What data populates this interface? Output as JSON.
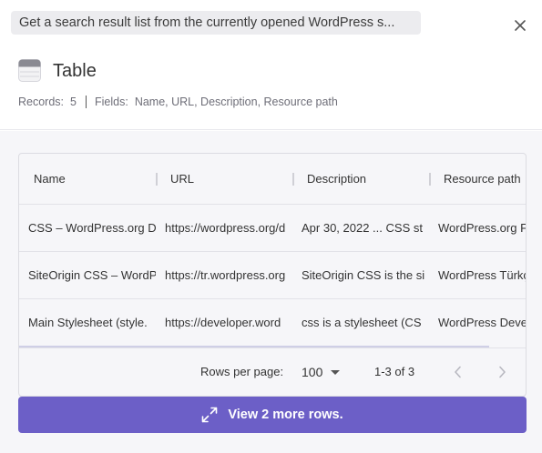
{
  "header": {
    "task_title": "Get a search result list from the currently opened WordPress s...",
    "heading": "Table",
    "records_label": "Records:",
    "records_value": "5",
    "fields_label": "Fields:",
    "fields_value": "Name, URL, Description, Resource path"
  },
  "icons": {
    "close": "close-icon",
    "table": "table-icon",
    "expand": "expand-icon",
    "prev": "chevron-left-icon",
    "next": "chevron-right-icon"
  },
  "table": {
    "columns": [
      "Name",
      "URL",
      "Description",
      "Resource path"
    ],
    "rows": [
      [
        "CSS – WordPress.org D",
        "https://wordpress.org/d",
        "Apr 30, 2022 ... CSS st",
        "WordPress.org Fo"
      ],
      [
        "SiteOrigin CSS – WordP",
        "https://tr.wordpress.org",
        "SiteOrigin CSS is the si",
        "WordPress Türkçe"
      ],
      [
        "Main Stylesheet (style.",
        "https://developer.word",
        "css is a stylesheet (CS",
        "WordPress Develo"
      ]
    ]
  },
  "pagination": {
    "rows_per_page_label": "Rows per page:",
    "rows_per_page_value": "100",
    "range_text": "1-3 of 3"
  },
  "more_button": {
    "label": "View 2 more rows."
  },
  "colors": {
    "accent": "#6c5fc7",
    "background": "#f6f6f9"
  }
}
